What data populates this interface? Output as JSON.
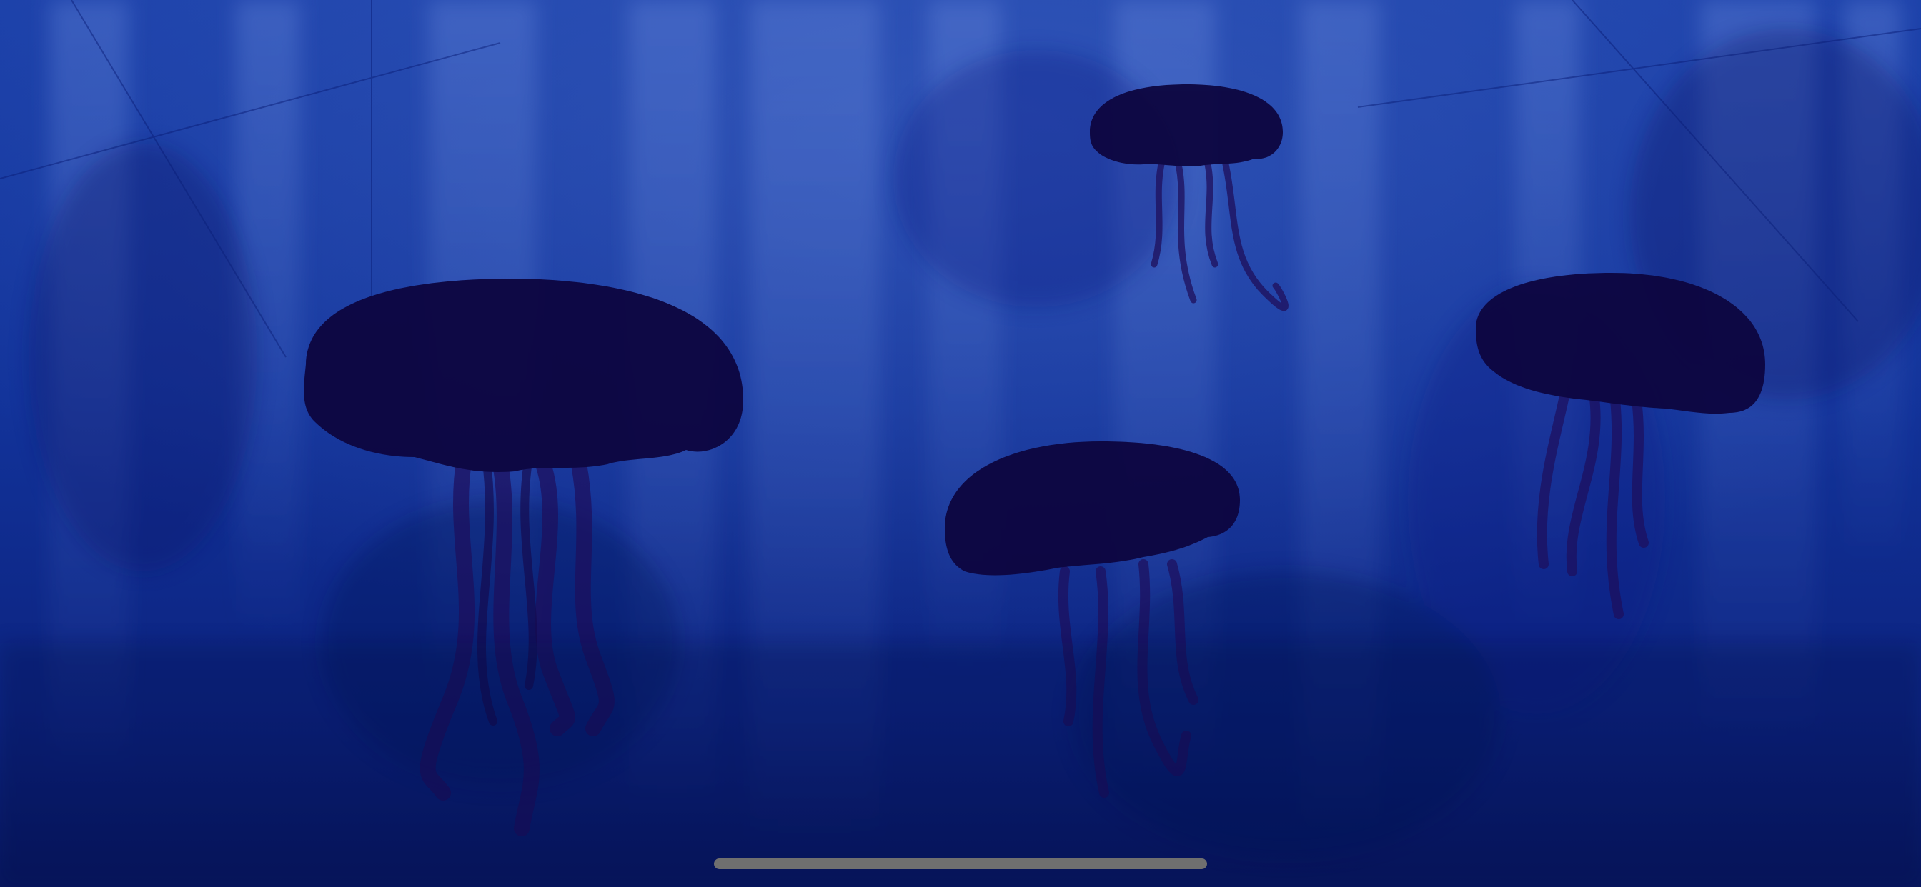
{
  "scene": {
    "name": "underwater-jellyfish-scene",
    "colors": {
      "water_top": "#1a3fa8",
      "water_mid": "#0f2e96",
      "water_bottom": "#0a1a6b",
      "light_streak": "#3a5fc4",
      "jellyfish_bell": "#0d0640",
      "jellyfish_tentacle": "#1a0d55",
      "home_indicator": "#6f6f6f"
    },
    "jellyfish_count": 4
  },
  "home_indicator": {
    "icon": "home-indicator-bar"
  }
}
